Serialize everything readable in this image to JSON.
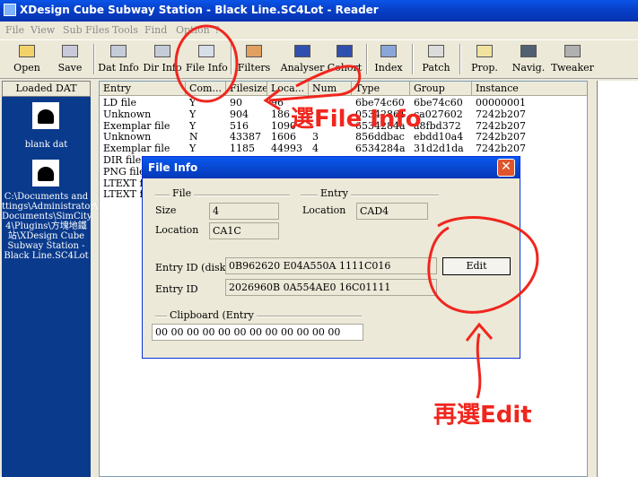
{
  "window": {
    "title": "XDesign Cube Subway Station - Black Line.SC4Lot - Reader"
  },
  "menu": [
    "File",
    "View",
    "Sub Files",
    "Tools",
    "Find",
    "Option",
    "?"
  ],
  "toolbar": {
    "buttons": [
      {
        "label": "Open",
        "icon": "open-icon"
      },
      {
        "label": "Save",
        "icon": "save-icon"
      },
      {
        "label": "Dat Info",
        "icon": "dat-info-icon"
      },
      {
        "label": "Dir Info",
        "icon": "dir-info-icon"
      },
      {
        "label": "File Info",
        "icon": "file-info-icon"
      },
      {
        "label": "Filters",
        "icon": "filters-icon"
      },
      {
        "label": "Analyser",
        "icon": "analyser-icon"
      },
      {
        "label": "Cohort",
        "icon": "cohort-icon"
      },
      {
        "label": "Index",
        "icon": "index-icon"
      },
      {
        "label": "Patch",
        "icon": "patch-icon"
      },
      {
        "label": "Prop.",
        "icon": "prop-icon"
      },
      {
        "label": "Navig.",
        "icon": "navig-icon"
      },
      {
        "label": "Tweaker",
        "icon": "tweaker-icon"
      }
    ]
  },
  "left_panel": {
    "header": "Loaded DAT",
    "items": [
      {
        "label": "blank dat"
      },
      {
        "label_lines": [
          "C:\\Documents and",
          "ttings\\Administrator\\M",
          "Documents\\SimCity",
          "4\\Plugins\\方塊地鐵",
          "站\\XDesign Cube",
          "Subway Station -",
          "Black Line.SC4Lot"
        ]
      }
    ]
  },
  "table": {
    "columns": [
      "Entry",
      "Com...",
      "Filesize",
      "Loca...",
      "Num",
      "Type",
      "Group",
      "Instance"
    ],
    "rows": [
      [
        "LD file",
        "Y",
        "90",
        "96",
        "",
        "6be74c60",
        "6be74c60",
        "00000001"
      ],
      [
        "Unknown",
        "Y",
        "904",
        "186",
        "",
        "05342861",
        "ca027602",
        "7242b207"
      ],
      [
        "Exemplar file",
        "Y",
        "516",
        "1090",
        "",
        "6534284a",
        "a8fbd372",
        "7242b207"
      ],
      [
        "Unknown",
        "N",
        "43387",
        "1606",
        "3",
        "856ddbac",
        "ebdd10a4",
        "7242b207"
      ],
      [
        "Exemplar file",
        "Y",
        "1185",
        "44993",
        "4",
        "6534284a",
        "31d2d1da",
        "7242b207"
      ],
      [
        "DIR file",
        "",
        "",
        "",
        "",
        "",
        "",
        ""
      ],
      [
        "PNG file",
        "",
        "",
        "",
        "",
        "",
        "",
        ""
      ],
      [
        "LTEXT f",
        "",
        "",
        "",
        "",
        "",
        "",
        ""
      ],
      [
        "LTEXT f",
        "",
        "",
        "",
        "",
        "",
        "",
        ""
      ]
    ]
  },
  "dialog": {
    "title": "File Info",
    "close_symbol": "✕",
    "file_group": "File",
    "entry_group": "Entry",
    "size_label": "Size",
    "size_value": "4",
    "file_location_label": "Location",
    "file_location_value": "CA1C",
    "entry_location_label": "Location",
    "entry_location_value": "CAD4",
    "entry_id_disk_label": "Entry ID (disk)",
    "entry_id_disk_value": "0B962620     E04A550A     1111C016",
    "entry_id_label": "Entry ID",
    "entry_id_value": "2026960B     0A554AE0     16C01111",
    "edit_button": "Edit",
    "clipboard_label": "Clipboard (Entry",
    "clipboard_value": "00 00 00 00 00 00 00 00 00 00 00 00"
  },
  "annotations": {
    "step1": "選File Info",
    "step2": "再選Edit",
    "color": "#f0261e"
  }
}
